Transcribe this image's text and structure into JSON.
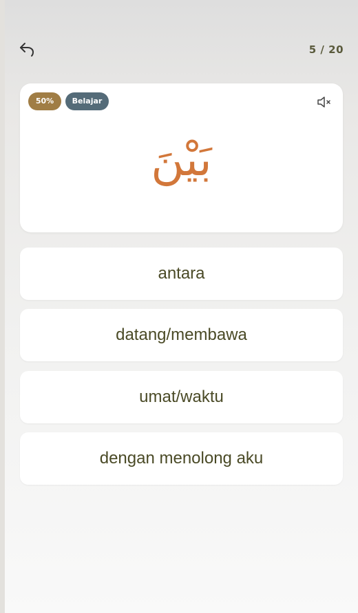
{
  "header": {
    "counter": "5 / 20"
  },
  "card": {
    "progress_badge": "50%",
    "mode_badge": "Belajar",
    "word": "بَيْنَ"
  },
  "options": [
    {
      "label": "antara"
    },
    {
      "label": "datang/membawa"
    },
    {
      "label": "umat/waktu"
    },
    {
      "label": "dengan menolong aku"
    }
  ],
  "colors": {
    "badge_gold": "#a07d45",
    "badge_slate": "#546b78",
    "arabic": "#d2773a",
    "option_text": "#4a4a26"
  },
  "icons": {
    "back": "undo-arrow-icon",
    "mute": "speaker-muted-icon"
  }
}
